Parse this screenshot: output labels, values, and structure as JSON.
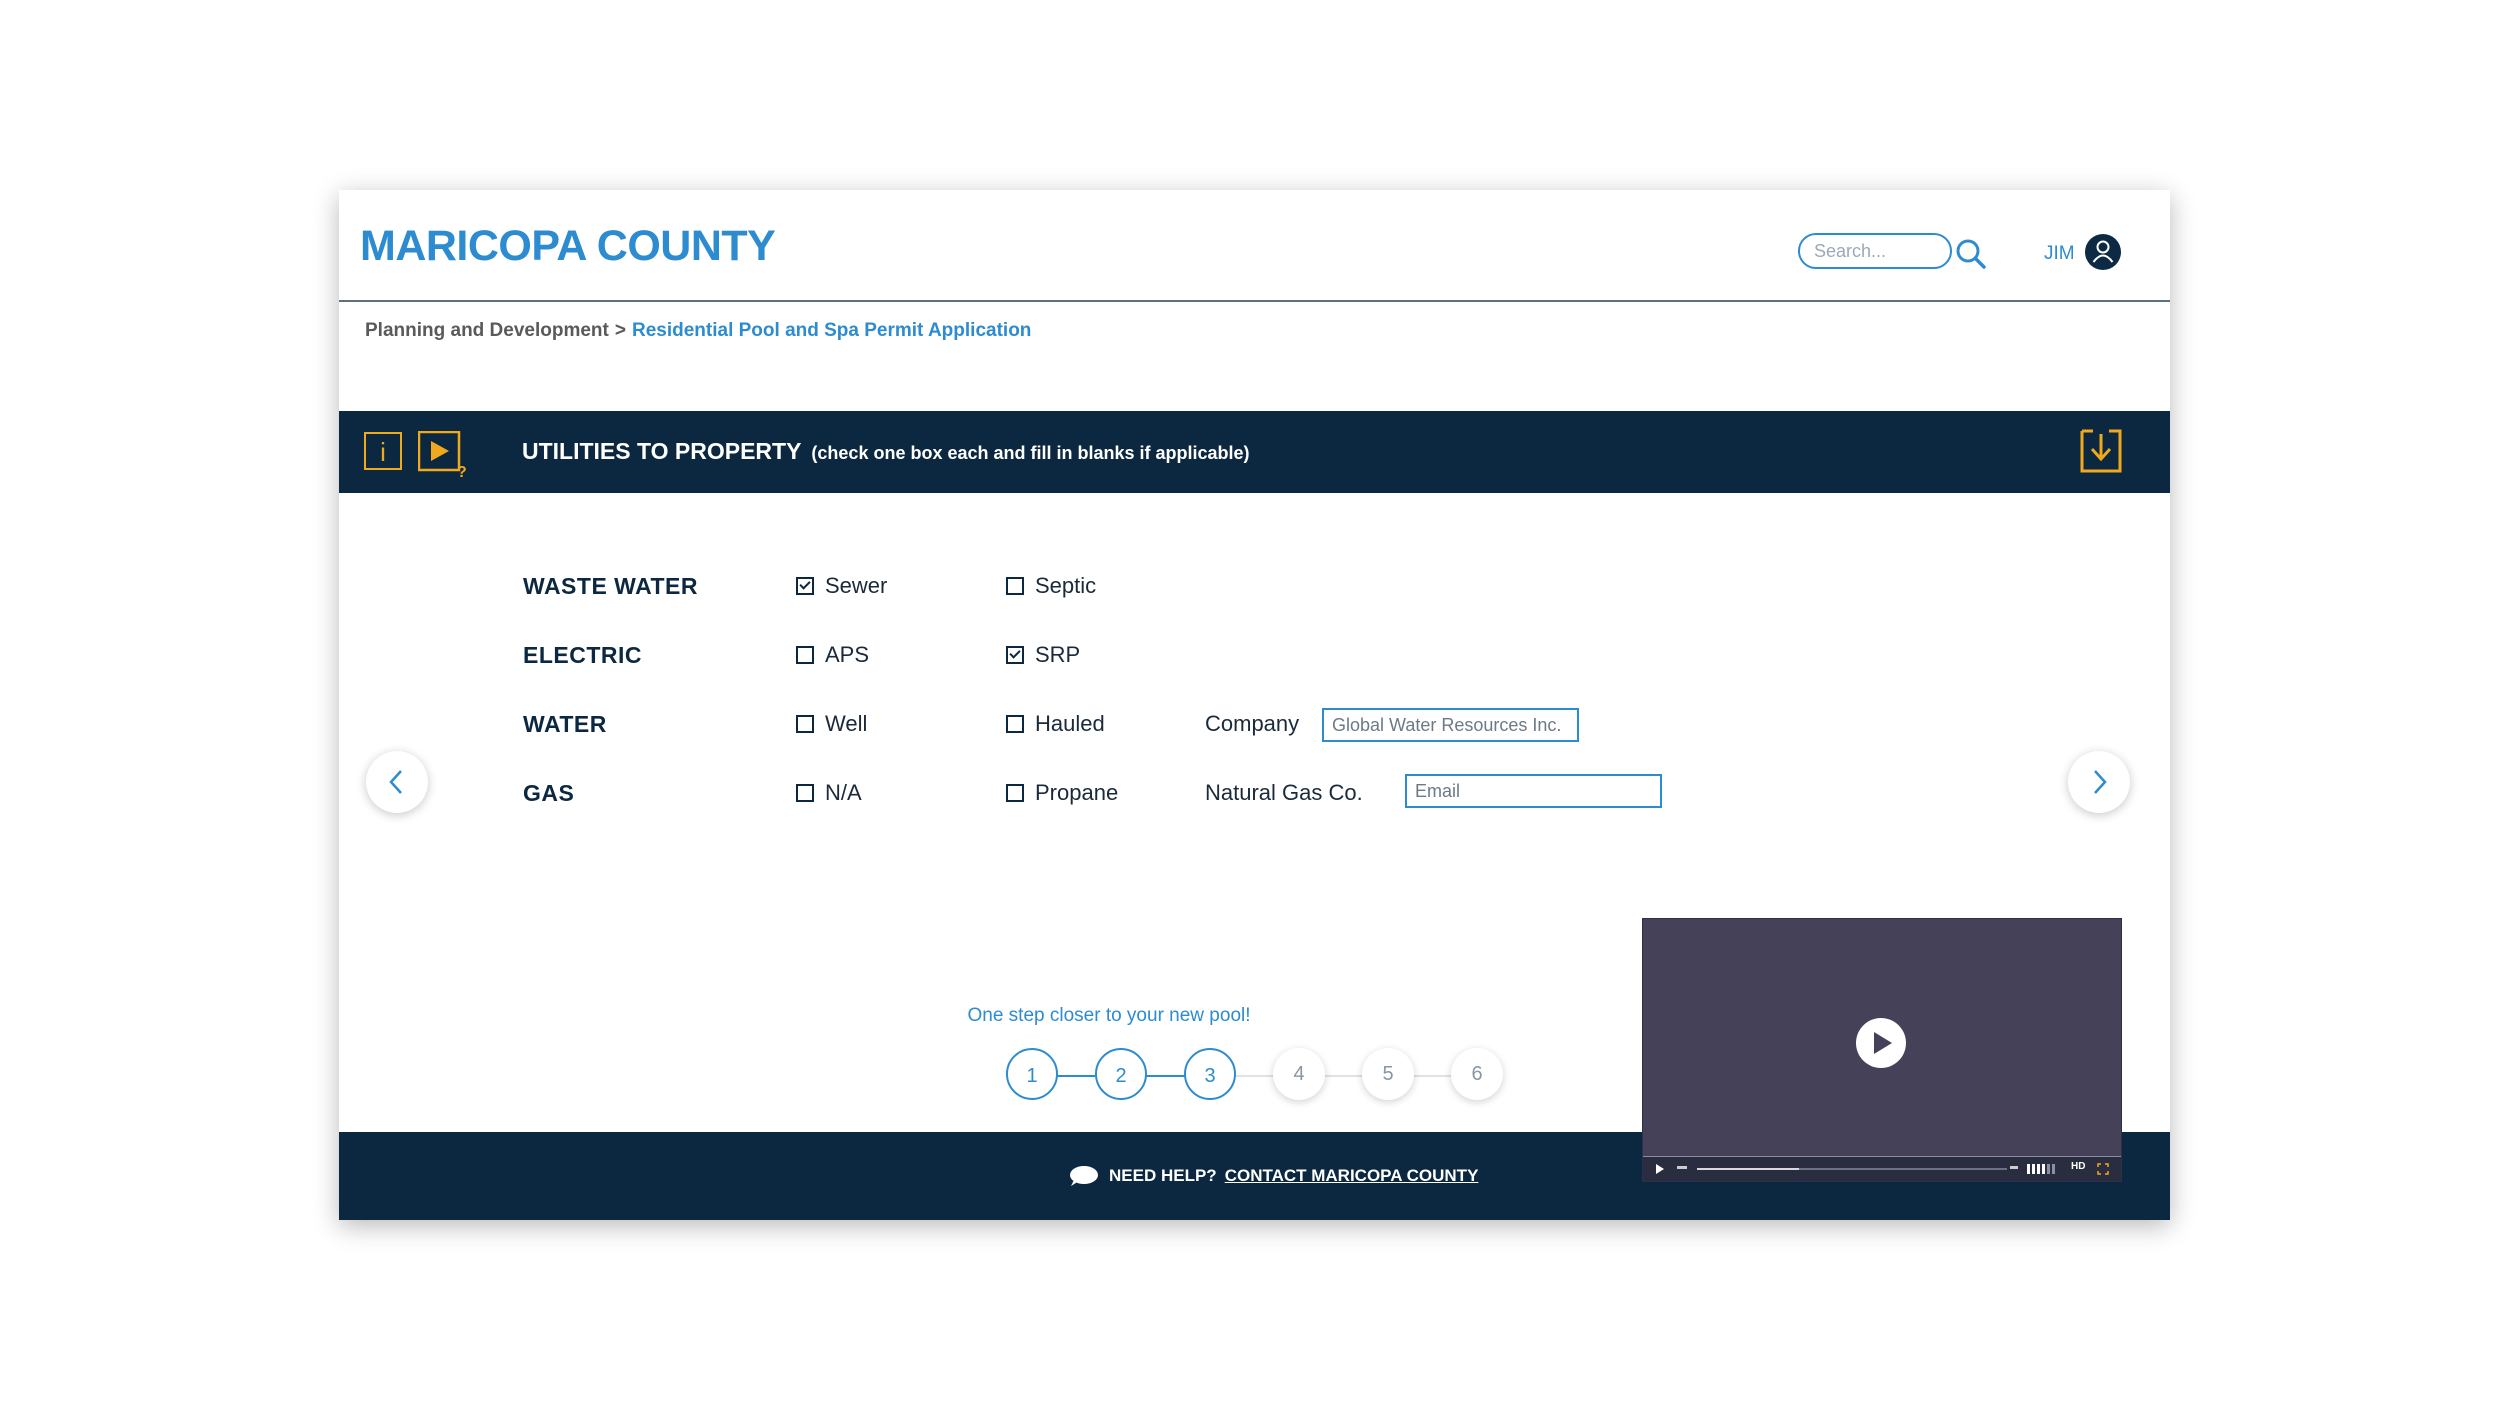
{
  "header": {
    "logo": "MARICOPA COUNTY",
    "search_placeholder": "Search...",
    "user_name": "JIM"
  },
  "breadcrumb": {
    "home": "Planning and Development",
    "separator": ">",
    "current": "Residential Pool and Spa Permit Application"
  },
  "section": {
    "title": "UTILITIES TO PROPERTY",
    "subtitle": "(check one box each and fill in blanks if applicable)",
    "info_icon_label": "i",
    "help_mark": "?"
  },
  "form": {
    "rows": [
      {
        "label": "WASTE WATER",
        "options": [
          {
            "label": "Sewer",
            "checked": true
          },
          {
            "label": "Septic",
            "checked": false
          }
        ]
      },
      {
        "label": "ELECTRIC",
        "options": [
          {
            "label": "APS",
            "checked": false
          },
          {
            "label": "SRP",
            "checked": true
          }
        ]
      },
      {
        "label": "WATER",
        "options": [
          {
            "label": "Well",
            "checked": false
          },
          {
            "label": "Hauled",
            "checked": false
          }
        ],
        "field": {
          "label": "Company",
          "value": "Global Water Resources Inc.",
          "placeholder": ""
        }
      },
      {
        "label": "GAS",
        "options": [
          {
            "label": "N/A",
            "checked": false
          },
          {
            "label": "Propane",
            "checked": false
          }
        ],
        "field": {
          "label": "Natural Gas Co.",
          "value": "",
          "placeholder": "Email"
        }
      }
    ]
  },
  "progress": {
    "caption": "One step closer to your new pool!",
    "steps": [
      "1",
      "2",
      "3",
      "4",
      "5",
      "6"
    ],
    "current_step": 3
  },
  "footer": {
    "help_label": "NEED HELP?",
    "contact_link": "CONTACT MARICOPA COUNTY"
  },
  "video": {
    "progress_fraction": 0.33,
    "quality_label": "HD"
  },
  "colors": {
    "brand_blue": "#2d8bd0",
    "navy": "#0c2840",
    "accent_gold": "#f0a81c",
    "video_bg": "#444159"
  },
  "icons": [
    "search-icon",
    "user-icon",
    "info-icon",
    "video-help-icon",
    "download-icon",
    "chevron-left-icon",
    "chevron-right-icon",
    "chat-icon",
    "play-icon",
    "fullscreen-icon"
  ]
}
